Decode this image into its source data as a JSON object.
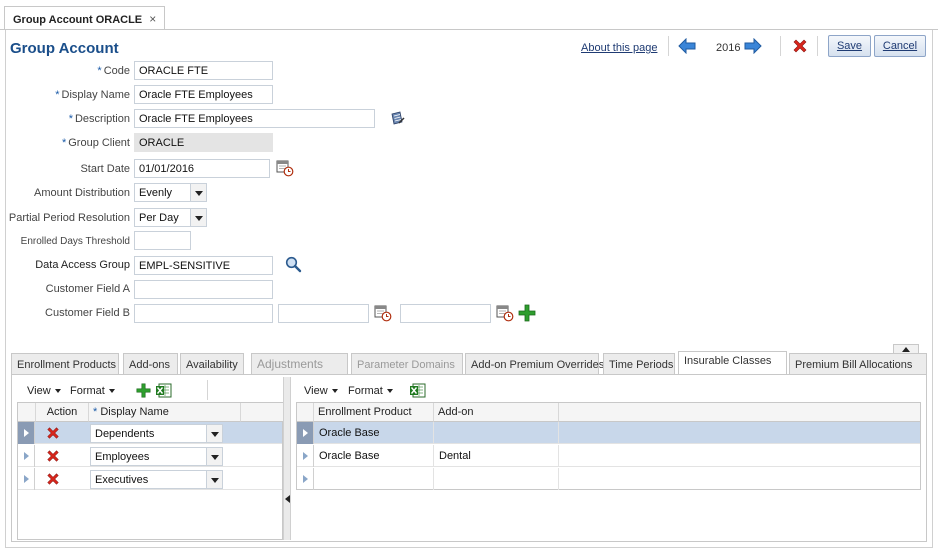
{
  "document_tab": {
    "title": "Group Account ORACLE",
    "close": "×"
  },
  "header": {
    "title": "Group Account",
    "about_link": "About this page",
    "year": "2016",
    "save_label": "Save",
    "cancel_label": "Cancel"
  },
  "form": {
    "code": {
      "label": "Code",
      "value": "ORACLE FTE"
    },
    "display_name": {
      "label": "Display Name",
      "value": "Oracle FTE Employees"
    },
    "description": {
      "label": "Description",
      "value": "Oracle FTE Employees"
    },
    "group_client": {
      "label": "Group Client",
      "value": "ORACLE"
    },
    "start_date": {
      "label": "Start Date",
      "value": "01/01/2016"
    },
    "amount_distribution": {
      "label": "Amount Distribution",
      "value": "Evenly"
    },
    "partial_period_resolution": {
      "label": "Partial Period Resolution",
      "value": "Per Day"
    },
    "enrolled_days_threshold": {
      "label": "Enrolled Days Threshold",
      "value": ""
    },
    "data_access_group": {
      "label": "Data Access Group",
      "value": "EMPL-SENSITIVE"
    },
    "customer_field_a": {
      "label": "Customer Field A",
      "value": ""
    },
    "customer_field_b": {
      "label": "Customer Field B",
      "value": ""
    },
    "required_mark": "*"
  },
  "subtabs": [
    {
      "label": "Enrollment Products",
      "state": "normal"
    },
    {
      "label": "Add-ons",
      "state": "normal"
    },
    {
      "label": "Availability",
      "state": "normal"
    },
    {
      "label": "Adjustments",
      "state": "disabled"
    },
    {
      "label": "Parameter Domains",
      "state": "disabled"
    },
    {
      "label": "Add-on Premium Overrides",
      "state": "normal"
    },
    {
      "label": "Time Periods",
      "state": "normal"
    },
    {
      "label": "Insurable Classes",
      "state": "active"
    },
    {
      "label": "Premium Bill Allocations",
      "state": "normal"
    }
  ],
  "left_grid": {
    "toolbar": {
      "view": "View",
      "format": "Format"
    },
    "headers": {
      "action": "Action",
      "display_name": "Display Name"
    },
    "rows": [
      {
        "display_name": "Dependents",
        "selected": true
      },
      {
        "display_name": "Employees",
        "selected": false
      },
      {
        "display_name": "Executives",
        "selected": false
      }
    ]
  },
  "right_grid": {
    "toolbar": {
      "view": "View",
      "format": "Format"
    },
    "headers": {
      "enrollment_product": "Enrollment Product",
      "add_on": "Add-on"
    },
    "rows": [
      {
        "enrollment_product": "Oracle Base",
        "add_on": "",
        "selected": true
      },
      {
        "enrollment_product": "Oracle Base",
        "add_on": "Dental",
        "selected": false
      },
      {
        "enrollment_product": "",
        "add_on": "",
        "selected": false
      }
    ]
  },
  "colors": {
    "title": "#1a4e8a",
    "selection": "#c8d7ea",
    "delete_red": "#d9261c",
    "add_green": "#2e9e2e"
  },
  "icons": [
    "close-icon",
    "prev-arrow-icon",
    "next-arrow-icon",
    "delete-icon",
    "edit-notes-icon",
    "calendar-icon",
    "search-icon",
    "add-icon",
    "export-excel-icon",
    "row-delete-icon"
  ]
}
